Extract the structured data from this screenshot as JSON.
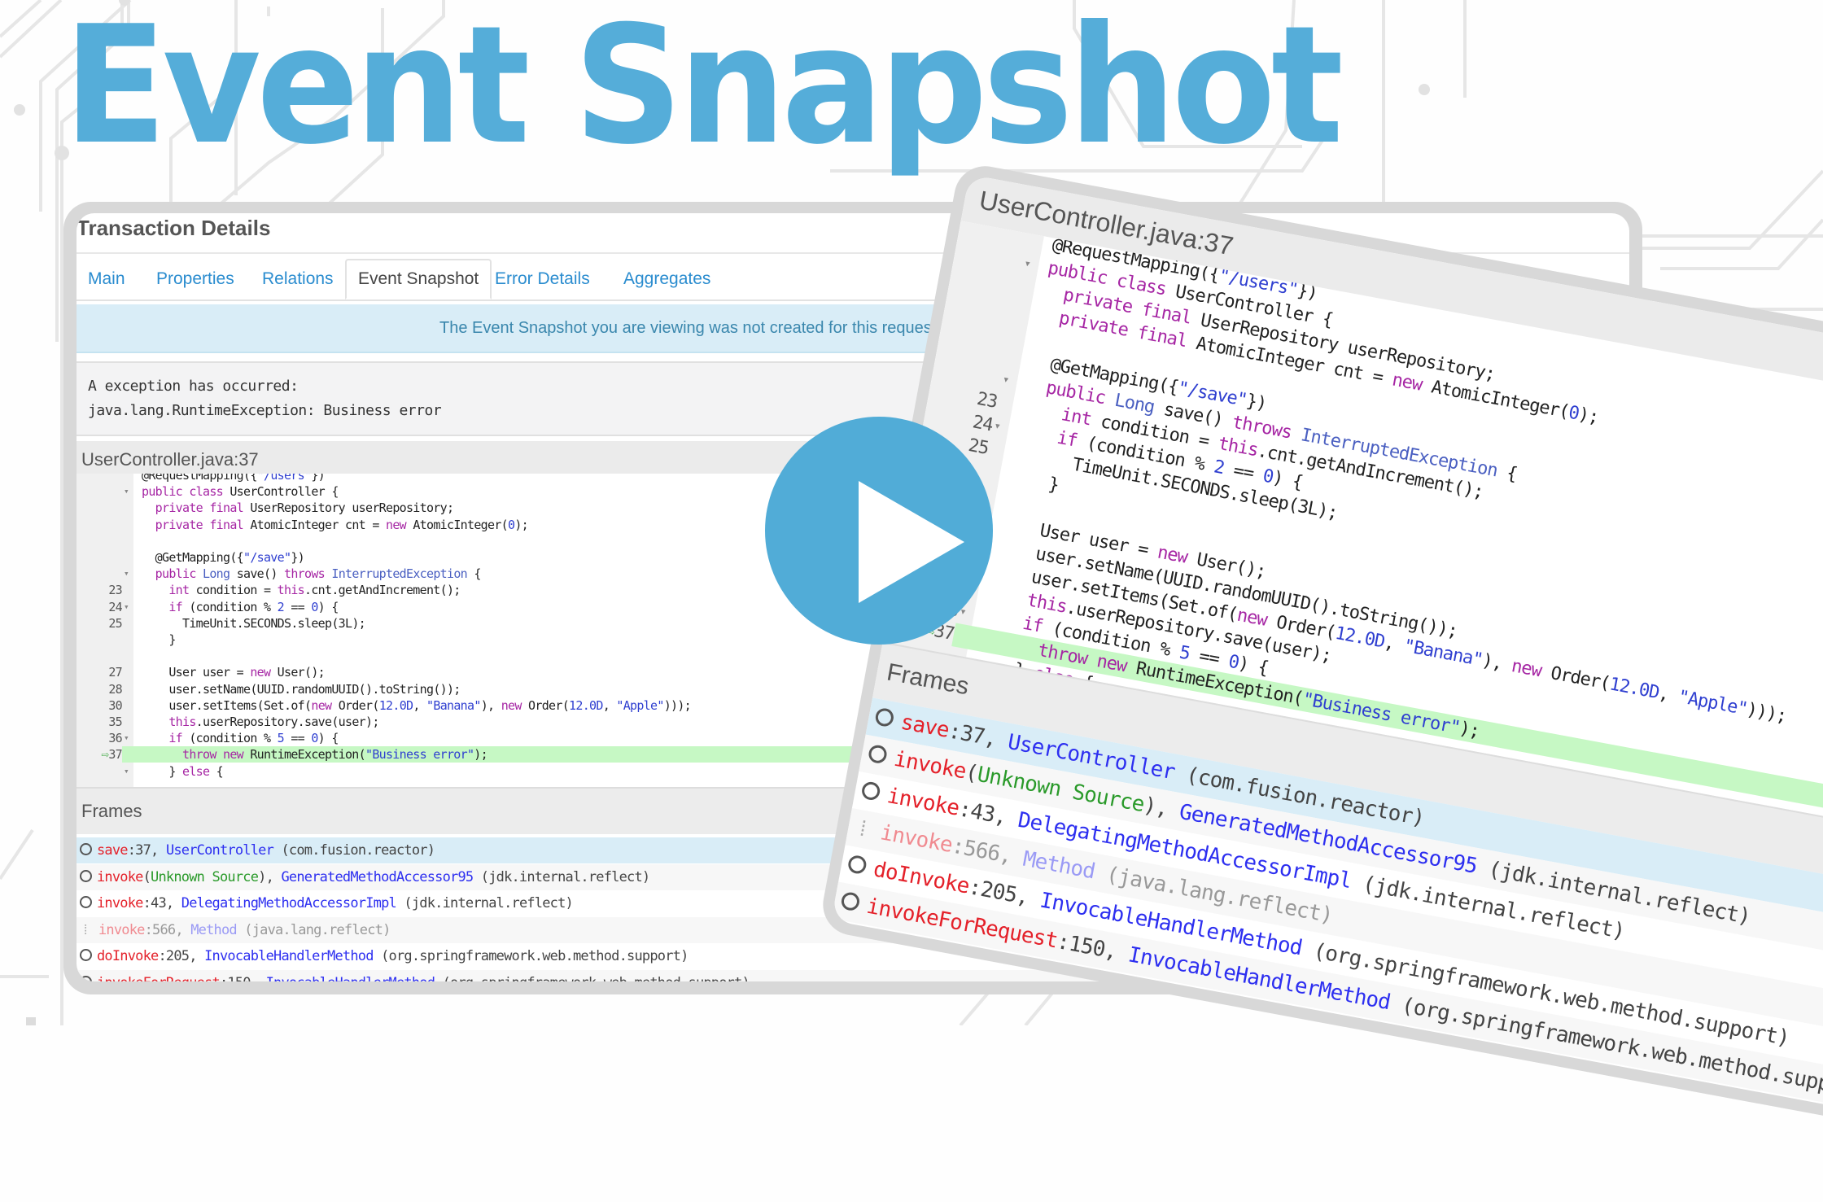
{
  "hero": {
    "title": "Event Snapshot"
  },
  "colors": {
    "brand": "#55add9",
    "play_button": "#51acd7",
    "highlight_line": "#c6f8c4",
    "selected_frame": "#d9edf7",
    "method": "#e4212a",
    "class": "#2d2ff0",
    "unknown_source": "#2a9a2a"
  },
  "transaction_panel": {
    "title": "Transaction Details",
    "tabs": [
      {
        "label": "Main",
        "active": false
      },
      {
        "label": "Properties",
        "active": false
      },
      {
        "label": "Relations",
        "active": false
      },
      {
        "label": "Event Snapshot",
        "active": true
      },
      {
        "label": "Error Details",
        "active": false
      },
      {
        "label": "Aggregates",
        "active": false
      }
    ],
    "notice": "The Event Snapshot you are viewing was not created for this request. A",
    "exception": {
      "line1": "A exception has occurred:",
      "line2": "java.lang.RuntimeException: Business error"
    },
    "source_title": "UserController.java:37",
    "frames_title": "Frames"
  },
  "code_lines": [
    {
      "ln": "",
      "fold": "",
      "text": "@RequestMapping({\"/users\"})"
    },
    {
      "ln": "",
      "fold": "▾",
      "text": "public class UserController {"
    },
    {
      "ln": "",
      "fold": "",
      "text": "  private final UserRepository userRepository;"
    },
    {
      "ln": "",
      "fold": "",
      "text": "  private final AtomicInteger cnt = new AtomicInteger(0);"
    },
    {
      "ln": "",
      "fold": "",
      "text": ""
    },
    {
      "ln": "",
      "fold": "",
      "text": "  @GetMapping({\"/save\"})"
    },
    {
      "ln": "",
      "fold": "▾",
      "text": "  public Long save() throws InterruptedException {"
    },
    {
      "ln": "23",
      "fold": "",
      "text": "    int condition = this.cnt.getAndIncrement();"
    },
    {
      "ln": "24",
      "fold": "▾",
      "text": "    if (condition % 2 == 0) {"
    },
    {
      "ln": "25",
      "fold": "",
      "text": "      TimeUnit.SECONDS.sleep(3L);"
    },
    {
      "ln": "",
      "fold": "",
      "text": "    }"
    },
    {
      "ln": "",
      "fold": "",
      "text": ""
    },
    {
      "ln": "27",
      "fold": "",
      "text": "    User user = new User();"
    },
    {
      "ln": "28",
      "fold": "",
      "text": "    user.setName(UUID.randomUUID().toString());"
    },
    {
      "ln": "30",
      "fold": "",
      "text": "    user.setItems(Set.of(new Order(12.0D, \"Banana\"), new Order(12.0D, \"Apple\")));"
    },
    {
      "ln": "35",
      "fold": "",
      "text": "    this.userRepository.save(user);"
    },
    {
      "ln": "36",
      "fold": "▾",
      "text": "    if (condition % 5 == 0) {"
    },
    {
      "ln": "37",
      "fold": "",
      "text": "      throw new RuntimeException(\"Business error\");",
      "current": true
    },
    {
      "ln": "",
      "fold": "▾",
      "text": "    } else {"
    }
  ],
  "frames": [
    {
      "method": "save",
      "loc": ":37, ",
      "cls": "UserController",
      "pkg": " (com.fusion.reactor)",
      "selected": true
    },
    {
      "method": "invoke",
      "loc": "(",
      "unknown": "Unknown Source",
      "loc2": "), ",
      "cls": "GeneratedMethodAccessor95",
      "pkg": " (jdk.internal.reflect)"
    },
    {
      "method": "invoke",
      "loc": ":43, ",
      "cls": "DelegatingMethodAccessorImpl",
      "pkg": " (jdk.internal.reflect)"
    },
    {
      "method": "invoke",
      "loc": ":566, ",
      "cls": "Method",
      "pkg": " (java.lang.reflect)",
      "faded": true
    },
    {
      "method": "doInvoke",
      "loc": ":205, ",
      "cls": "InvocableHandlerMethod",
      "pkg": " (org.springframework.web.method.support)"
    },
    {
      "method": "invokeForRequest",
      "loc": ":150, ",
      "cls": "InvocableHandlerMethod",
      "pkg": " (org.springframework.web.method.support)"
    }
  ],
  "play_button": {
    "icon": "play-icon"
  }
}
